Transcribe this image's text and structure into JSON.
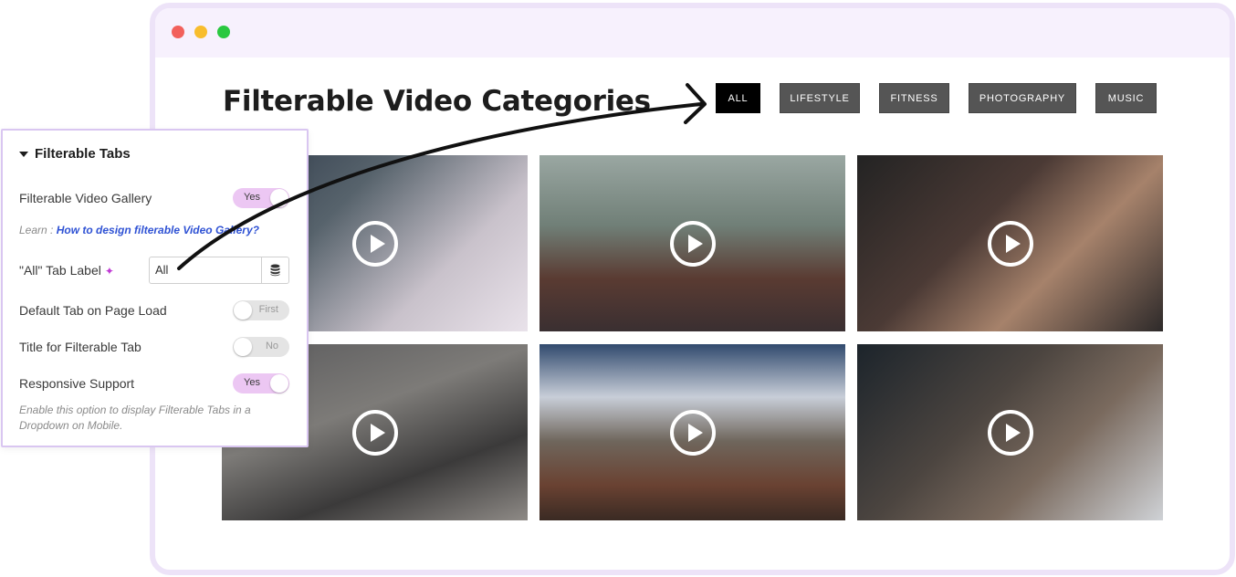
{
  "page": {
    "title": "Filterable Video Categories"
  },
  "tabs": [
    {
      "label": "ALL",
      "active": true
    },
    {
      "label": "LIFESTYLE",
      "active": false
    },
    {
      "label": "FITNESS",
      "active": false
    },
    {
      "label": "PHOTOGRAPHY",
      "active": false
    },
    {
      "label": "MUSIC",
      "active": false
    }
  ],
  "videos": [
    {
      "subject": "tattooed shoulder woman"
    },
    {
      "subject": "woman with camera"
    },
    {
      "subject": "man playing guitar"
    },
    {
      "subject": "barbell deadlift"
    },
    {
      "subject": "mountain hiker"
    },
    {
      "subject": "man at laptop"
    }
  ],
  "panel": {
    "title": "Filterable Tabs",
    "filterable_gallery": {
      "label": "Filterable Video Gallery",
      "toggle": "Yes",
      "on": true
    },
    "learn": {
      "prefix": "Learn : ",
      "link": "How to design filterable Video Gallery?"
    },
    "all_tab_label": {
      "label": "\"All\" Tab Label",
      "value": "All"
    },
    "default_tab": {
      "label": "Default Tab on Page Load",
      "toggle": "First",
      "on": false
    },
    "title_tab": {
      "label": "Title for Filterable Tab",
      "toggle": "No",
      "on": false
    },
    "responsive": {
      "label": "Responsive Support",
      "toggle": "Yes",
      "on": true
    },
    "hint": "Enable this option to display Filterable Tabs in a Dropdown on Mobile."
  },
  "icons": {
    "sparkle": "sparkle-icon",
    "database": "database-icon",
    "play": "play-icon",
    "caret": "caret-down-icon"
  },
  "colors": {
    "accent": "#ecc7f3",
    "frame": "#ede3f8",
    "tab": "#555555",
    "tab_active": "#000000",
    "link": "#2f52d4"
  }
}
